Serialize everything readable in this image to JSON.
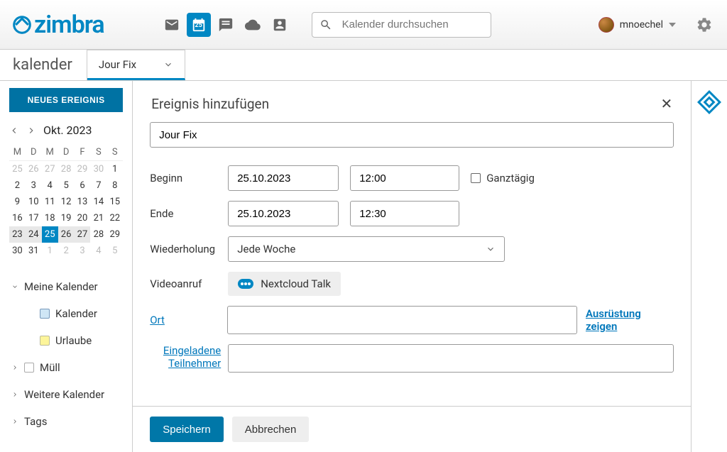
{
  "topbar": {
    "logo_text": "zimbra",
    "calendar_date": "25",
    "search_placeholder": "Kalender durchsuchen",
    "username": "mnoechel"
  },
  "tabs": {
    "section_label": "kalender",
    "active_tab": "Jour Fix"
  },
  "sidebar": {
    "new_event_label": "NEUES EREIGNIS",
    "month_label": "Okt. 2023",
    "weekdays": [
      "M",
      "D",
      "M",
      "D",
      "F",
      "S",
      "S"
    ],
    "days": [
      {
        "n": "25",
        "o": true
      },
      {
        "n": "26",
        "o": true
      },
      {
        "n": "27",
        "o": true
      },
      {
        "n": "28",
        "o": true
      },
      {
        "n": "29",
        "o": true
      },
      {
        "n": "30",
        "o": true
      },
      {
        "n": "1"
      },
      {
        "n": "2"
      },
      {
        "n": "3"
      },
      {
        "n": "4"
      },
      {
        "n": "5"
      },
      {
        "n": "6"
      },
      {
        "n": "7"
      },
      {
        "n": "8"
      },
      {
        "n": "9"
      },
      {
        "n": "10"
      },
      {
        "n": "11"
      },
      {
        "n": "12"
      },
      {
        "n": "13"
      },
      {
        "n": "14"
      },
      {
        "n": "15"
      },
      {
        "n": "16"
      },
      {
        "n": "17"
      },
      {
        "n": "18"
      },
      {
        "n": "19"
      },
      {
        "n": "20"
      },
      {
        "n": "21"
      },
      {
        "n": "22"
      },
      {
        "n": "23",
        "b": true
      },
      {
        "n": "24",
        "b": true
      },
      {
        "n": "25",
        "s": true
      },
      {
        "n": "26",
        "b": true
      },
      {
        "n": "27",
        "b": true
      },
      {
        "n": "28"
      },
      {
        "n": "29"
      },
      {
        "n": "30"
      },
      {
        "n": "31"
      },
      {
        "n": "1",
        "o": true
      },
      {
        "n": "2",
        "o": true
      },
      {
        "n": "3",
        "o": true
      },
      {
        "n": "4",
        "o": true
      },
      {
        "n": "5",
        "o": true
      }
    ],
    "groups": {
      "my_calendars": "Meine Kalender",
      "kalender": "Kalender",
      "urlaube": "Urlaube",
      "mull": "Müll",
      "other_cals": "Weitere Kalender",
      "tags": "Tags"
    }
  },
  "form": {
    "title": "Ereignis hinzufügen",
    "event_title": "Jour Fix",
    "begin_label": "Beginn",
    "begin_date": "25.10.2023",
    "begin_time": "12:00",
    "allday_label": "Ganztägig",
    "end_label": "Ende",
    "end_date": "25.10.2023",
    "end_time": "12:30",
    "repeat_label": "Wiederholung",
    "repeat_value": "Jede Woche",
    "video_label": "Videoanruf",
    "video_chip": "Nextcloud Talk",
    "location_label": "Ort",
    "equipment_link": "Ausrüstung zeigen",
    "invitees_label_1": "Eingeladene",
    "invitees_label_2": "Teilnehmer",
    "save_label": "Speichern",
    "cancel_label": "Abbrechen"
  }
}
